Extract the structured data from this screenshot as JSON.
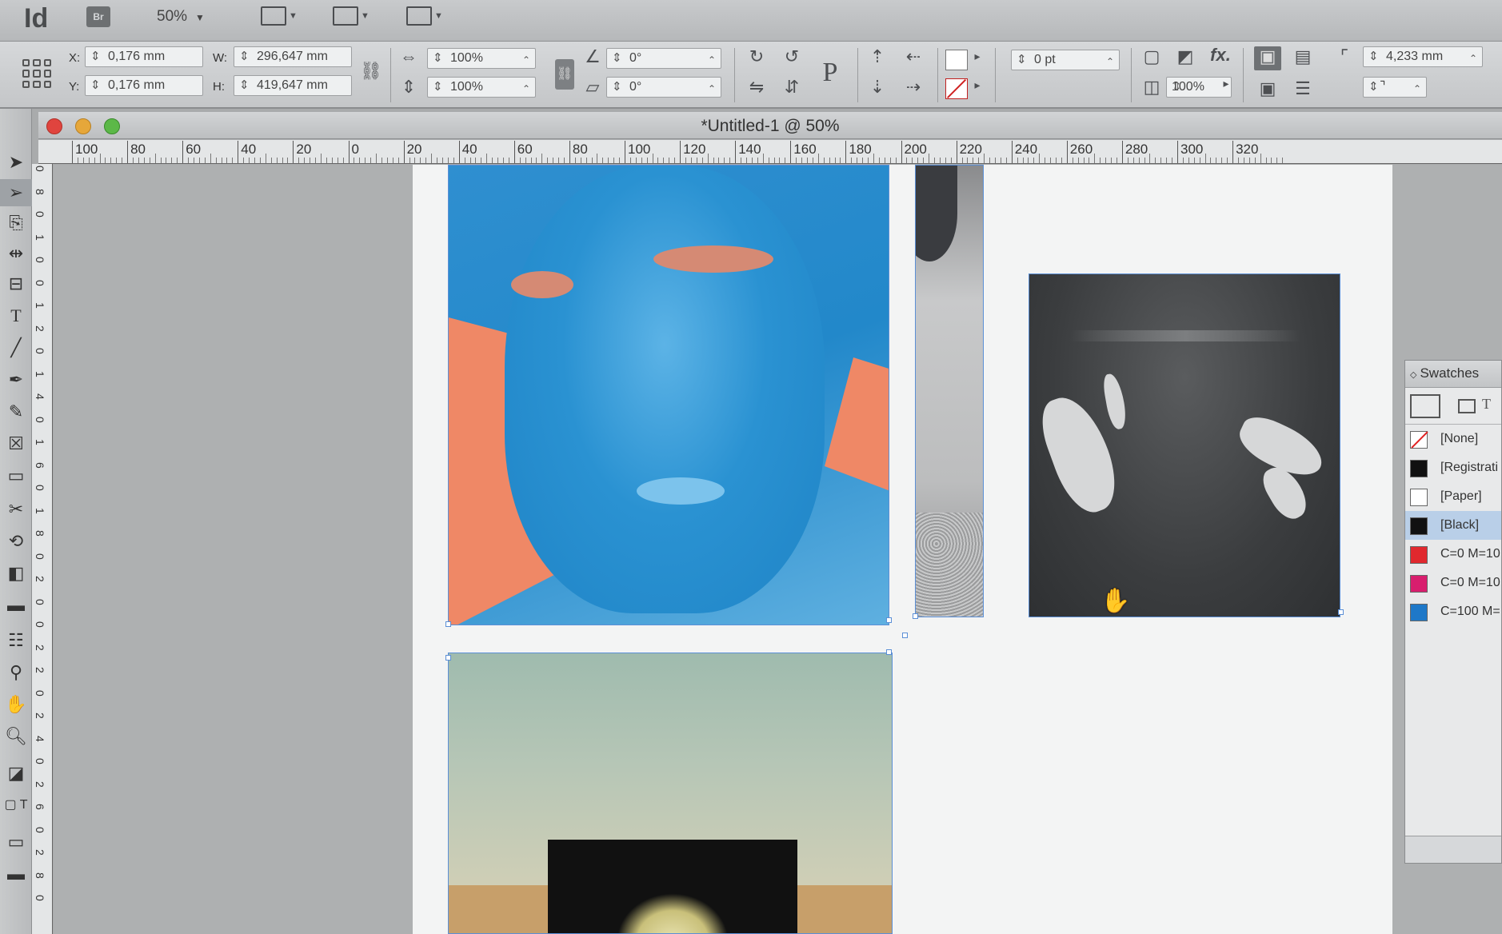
{
  "app": {
    "logo": "Id",
    "bridge_label": "Br",
    "zoom": "50%"
  },
  "control_panel": {
    "x_label": "X:",
    "x_value": "0,176 mm",
    "y_label": "Y:",
    "y_value": "0,176 mm",
    "w_label": "W:",
    "w_value": "296,647 mm",
    "h_label": "H:",
    "h_value": "419,647 mm",
    "scale_x": "100%",
    "scale_y": "100%",
    "rotation": "0°",
    "shear": "0°",
    "stroke_weight": "0 pt",
    "opacity": "100%",
    "offset": "4,233 mm",
    "fx_label": "fx.",
    "p_label": "P"
  },
  "document": {
    "title": "*Untitled-1 @ 50%"
  },
  "ruler": {
    "horizontal": [
      "100",
      "80",
      "60",
      "40",
      "20",
      "0",
      "20",
      "40",
      "60",
      "80",
      "100",
      "120",
      "140",
      "160",
      "180",
      "200",
      "220",
      "240",
      "260",
      "280",
      "300",
      "320"
    ],
    "vertical": [
      "0",
      "8",
      "0",
      "1",
      "0",
      "0",
      "1",
      "2",
      "0",
      "1",
      "4",
      "0",
      "1",
      "6",
      "0",
      "1",
      "8",
      "0",
      "2",
      "0",
      "0",
      "2",
      "2",
      "0",
      "2",
      "4",
      "0",
      "2",
      "6",
      "0",
      "2",
      "8",
      "0"
    ]
  },
  "swatches": {
    "title": "Swatches",
    "items": [
      {
        "label": "[None]",
        "color": "#ffffff",
        "kind": "none"
      },
      {
        "label": "[Registrati",
        "color": "#111111"
      },
      {
        "label": "[Paper]",
        "color": "#ffffff"
      },
      {
        "label": "[Black]",
        "color": "#111111",
        "selected": true
      },
      {
        "label": "C=0 M=10",
        "color": "#e0282e"
      },
      {
        "label": "C=0 M=10",
        "color": "#d81e6e"
      },
      {
        "label": "C=100 M=",
        "color": "#1e78c8"
      }
    ]
  },
  "colors": {
    "selection": "#5b8fd6",
    "buddha_blue": "#2a92d2",
    "salmon": "#ef8866"
  }
}
